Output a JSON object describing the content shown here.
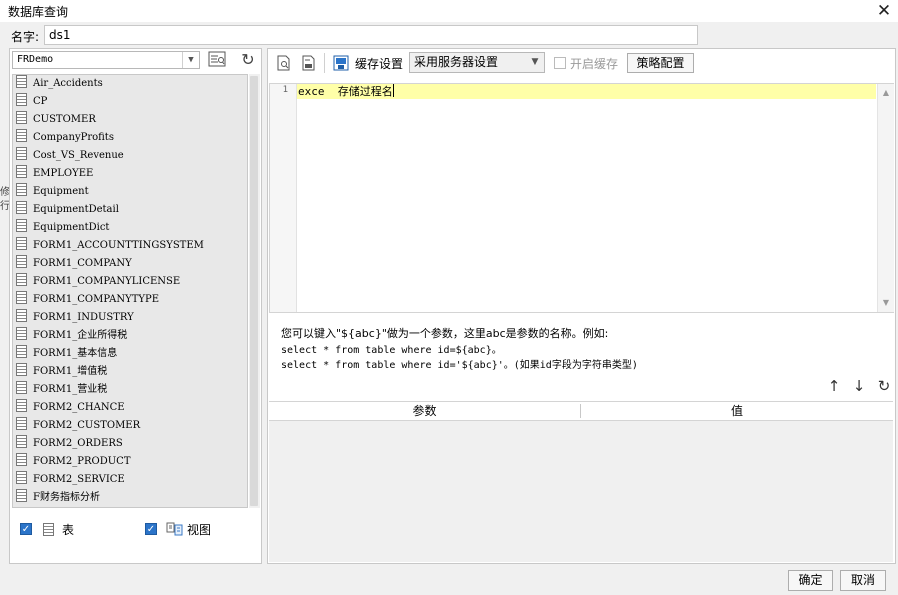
{
  "window": {
    "title": "数据库查询"
  },
  "name_field": {
    "label": "名字:",
    "value": "ds1"
  },
  "left_edge_chars": [
    "修",
    "行"
  ],
  "left_panel": {
    "connection": "FRDemo",
    "tables": [
      "Air_Accidents",
      "CP",
      "CUSTOMER",
      "CompanyProfits",
      "Cost_VS_Revenue",
      "EMPLOYEE",
      "Equipment",
      "EquipmentDetail",
      "EquipmentDict",
      "FORM1_ACCOUNTTINGSYSTEM",
      "FORM1_COMPANY",
      "FORM1_COMPANYLICENSE",
      "FORM1_COMPANYTYPE",
      "FORM1_INDUSTRY",
      "FORM1_企业所得税",
      "FORM1_基本信息",
      "FORM1_增值税",
      "FORM1_营业税",
      "FORM2_CHANCE",
      "FORM2_CUSTOMER",
      "FORM2_ORDERS",
      "FORM2_PRODUCT",
      "FORM2_SERVICE",
      "F财务指标分析"
    ],
    "filter_table_label": "表",
    "filter_view_label": "视图"
  },
  "toolbar": {
    "cache_label": "缓存设置",
    "cache_select": "采用服务器设置",
    "enable_cache_label": "开启缓存",
    "strategy_button": "策略配置"
  },
  "editor": {
    "line_numbers": [
      "1"
    ],
    "lines": [
      "exce  存储过程名"
    ]
  },
  "hint": {
    "line1": "您可以键入\"${abc}\"做为一个参数，这里abc是参数的名称。例如:",
    "line2": "select * from table where id=${abc}。",
    "line3": "select * from table where id='${abc}'。(如果id字段为字符串类型)"
  },
  "params_table": {
    "columns": [
      "参数",
      "值"
    ],
    "rows": []
  },
  "footer": {
    "ok": "确定",
    "cancel": "取消"
  },
  "colors": {
    "accent": "#2b74c9",
    "current_line": "#ffffa8"
  }
}
